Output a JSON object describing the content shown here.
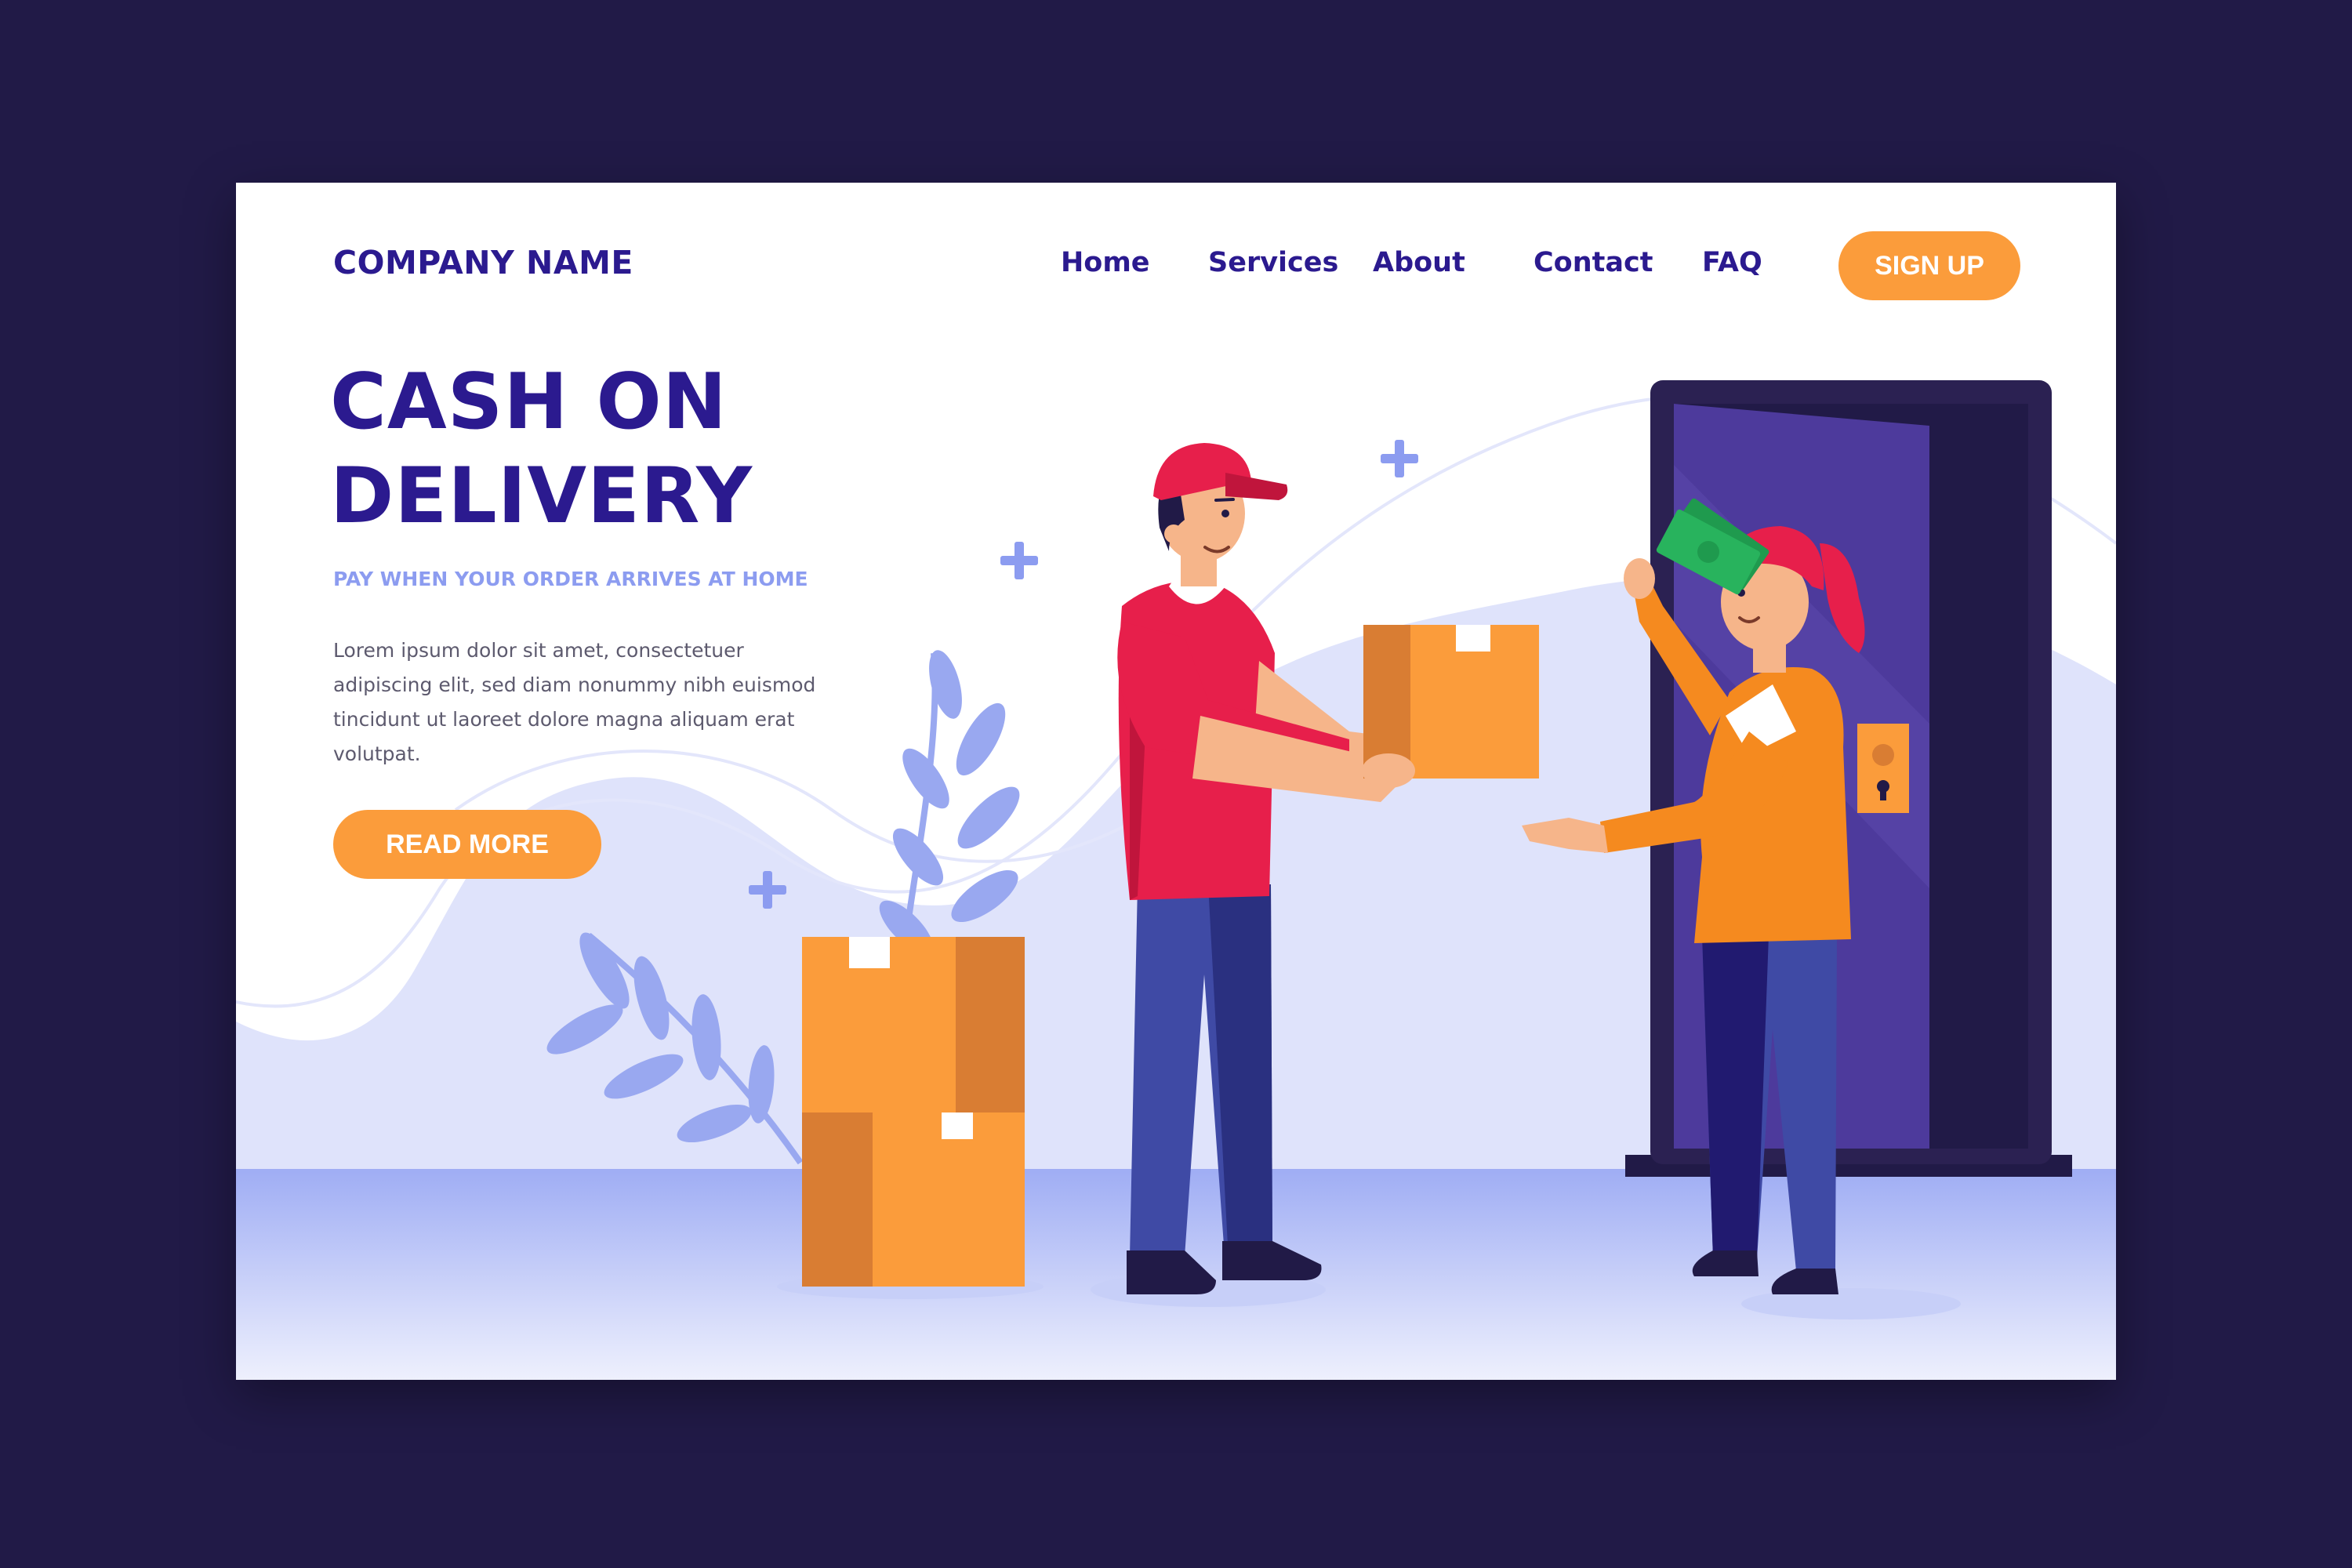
{
  "header": {
    "logo": "COMPANY NAME",
    "nav": [
      {
        "label": "Home"
      },
      {
        "label": "Services"
      },
      {
        "label": "About"
      },
      {
        "label": "Contact"
      },
      {
        "label": "FAQ"
      }
    ],
    "signup_label": "SIGN UP"
  },
  "hero": {
    "title_line1": "CASH ON",
    "title_line2": "DELIVERY",
    "subtitle": "PAY WHEN YOUR ORDER ARRIVES AT HOME",
    "body": "Lorem ipsum dolor sit amet, consectetuer adipiscing elit, sed diam nonummy nibh euismod tincidunt ut laoreet dolore magna aliquam erat volutpat.",
    "read_more_label": "READ MORE"
  },
  "colors": {
    "background": "#211a47",
    "brand": "#2b1a8f",
    "accent": "#fb9c3b",
    "soft_blue": "#dfe3fb",
    "floor": "#a9b6f5"
  },
  "icons": [
    "plus-icon",
    "leaf-icon",
    "door-keyhole-icon"
  ]
}
